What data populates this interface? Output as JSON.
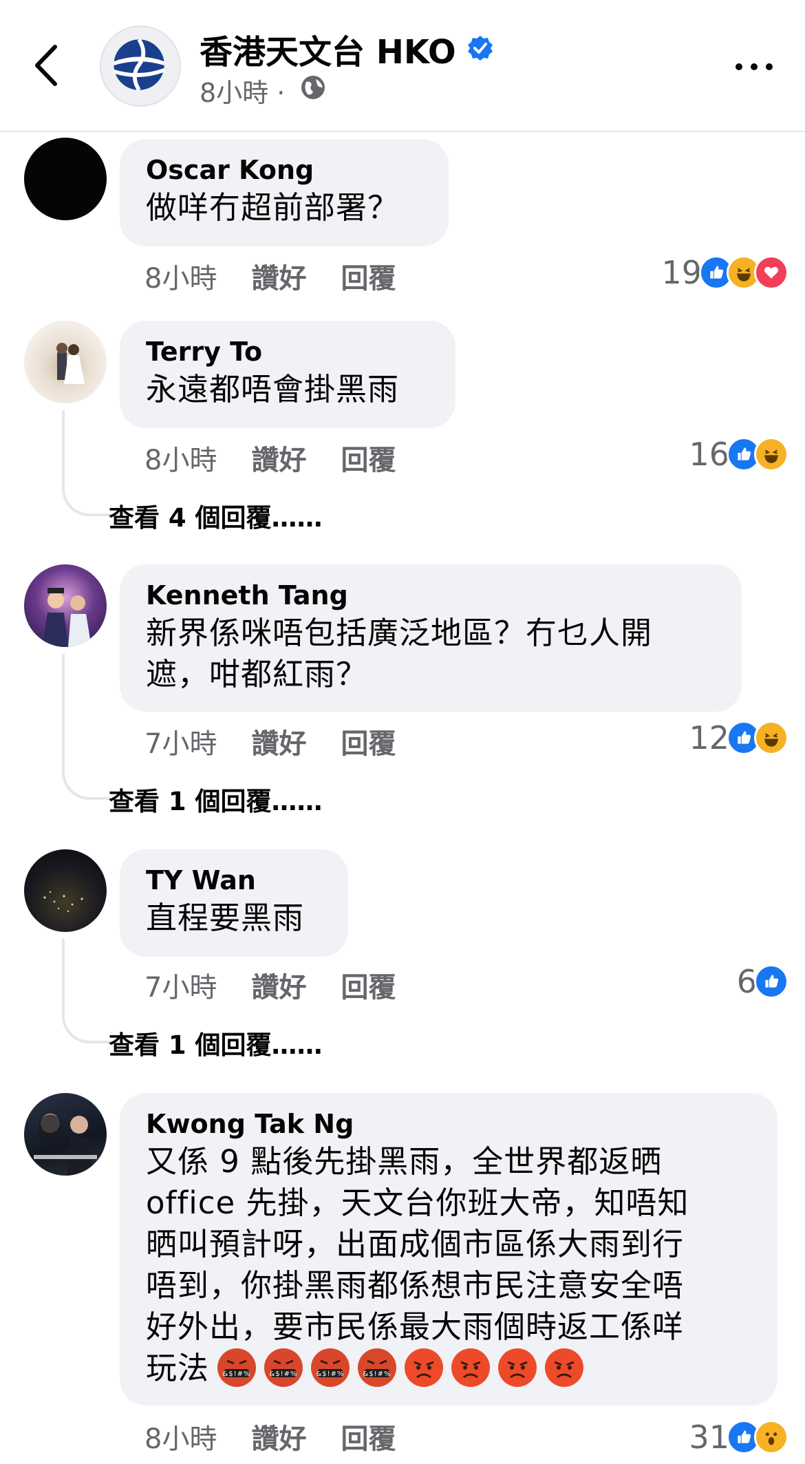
{
  "header": {
    "page_name": "香港天文台 HKO",
    "time": "8小時 ·"
  },
  "comments": [
    {
      "author": "Oscar Kong",
      "text": "做咩冇超前部署？",
      "time": "8小時",
      "like": "讚好",
      "reply": "回覆",
      "reaction_count": "19",
      "reactions": [
        "like-icon",
        "haha-icon",
        "love-icon"
      ]
    },
    {
      "author": "Terry To",
      "text": "永遠都唔會掛黑雨",
      "time": "8小時",
      "like": "讚好",
      "reply": "回覆",
      "reaction_count": "16",
      "reactions": [
        "like-icon",
        "haha-icon"
      ],
      "view_replies": "查看 4 個回覆……"
    },
    {
      "author": "Kenneth Tang",
      "text_lines": [
        "新界係咪唔包括廣泛地區？冇乜人開",
        "遮，咁都紅雨？"
      ],
      "time": "7小時",
      "like": "讚好",
      "reply": "回覆",
      "reaction_count": "12",
      "reactions": [
        "like-icon",
        "haha-icon"
      ],
      "view_replies": "查看 1 個回覆……"
    },
    {
      "author": "TY Wan",
      "text": "直程要黑雨",
      "time": "7小時",
      "like": "讚好",
      "reply": "回覆",
      "reaction_count": "6",
      "reactions": [
        "like-icon"
      ],
      "view_replies": "查看 1 個回覆……"
    },
    {
      "author": "Kwong Tak Ng",
      "text_lines": [
        "又係 9 點後先掛黑雨，全世界都返晒",
        "office 先掛，天文台你班大帝，知唔知",
        "晒叫預計呀，出面成個市區係大雨到行",
        "唔到，你掛黑雨都係想市民注意安全唔",
        "好外出，要市民係最大雨個時返工係咩",
        "玩法"
      ],
      "emojis": [
        "cursing-face-emoji",
        "cursing-face-emoji",
        "cursing-face-emoji",
        "cursing-face-emoji",
        "angry-face-emoji",
        "angry-face-emoji",
        "angry-face-emoji",
        "angry-face-emoji"
      ],
      "time": "8小時",
      "like": "讚好",
      "reply": "回覆",
      "reaction_count": "31",
      "reactions": [
        "like-icon",
        "wow-icon"
      ]
    }
  ]
}
